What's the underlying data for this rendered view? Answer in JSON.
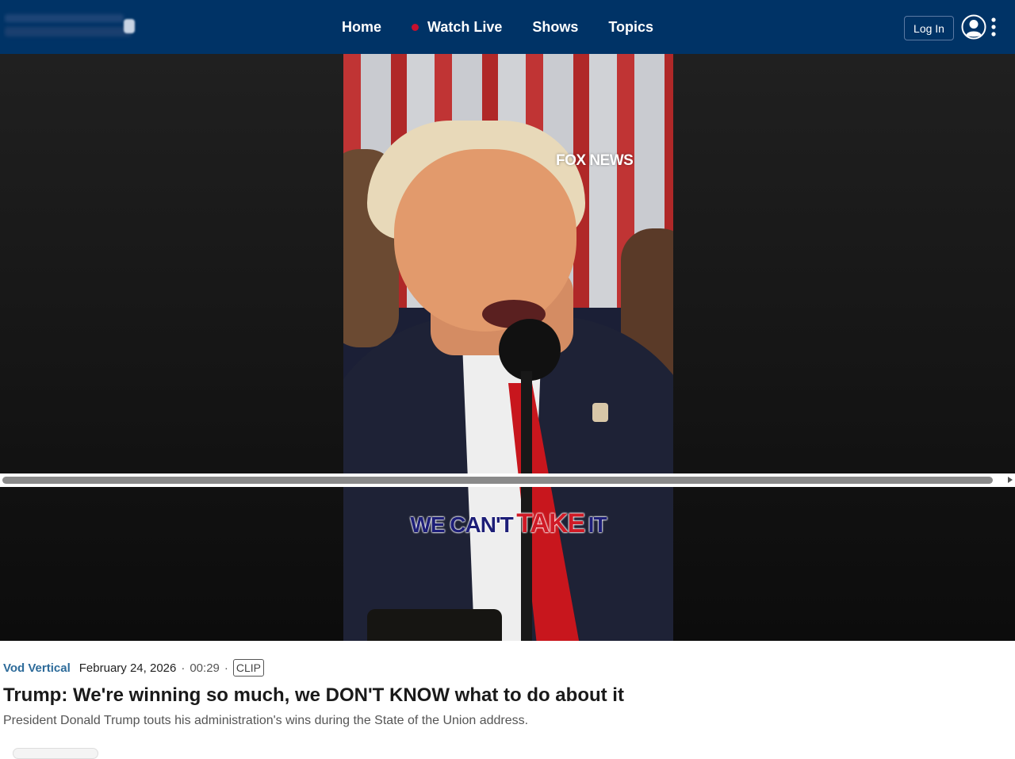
{
  "header": {
    "logo_name": "Fox News logo",
    "nav": [
      {
        "label": "Home"
      },
      {
        "label": "Watch Live",
        "live_dot_color": "#c8102e"
      },
      {
        "label": "Shows"
      },
      {
        "label": "Topics"
      }
    ],
    "login_label": "Log In",
    "background_color": "#003366"
  },
  "video": {
    "watermark": "FOX NEWS",
    "caption_part1": "WE CAN'T",
    "caption_part2": "TAKE",
    "caption_part3": "IT"
  },
  "meta": {
    "category": "Vod Vertical",
    "date": "February 24, 2026",
    "separator": "·",
    "duration": "00:29",
    "badge": "CLIP"
  },
  "article": {
    "title": "Trump: We're winning so much, we DON'T KNOW what to do about it",
    "description": "President Donald Trump touts his administration's wins during the State of the Union address."
  },
  "icons": {
    "user": "user-circle-icon",
    "more": "vertical-dots-icon"
  }
}
